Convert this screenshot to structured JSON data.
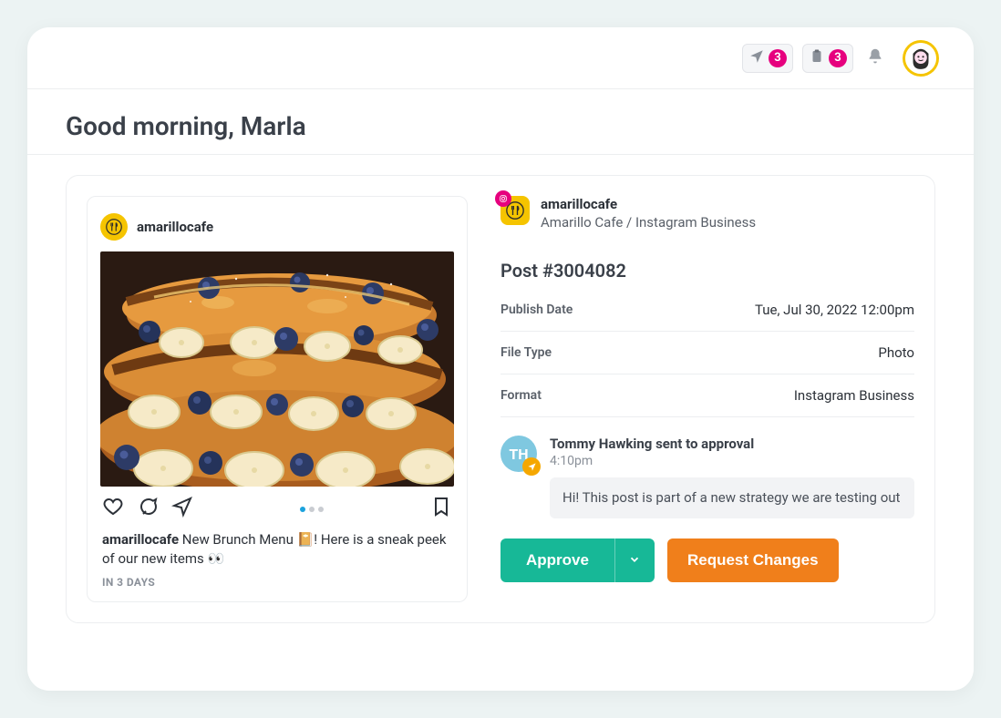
{
  "header": {
    "send_count": "3",
    "tasks_count": "3"
  },
  "greeting": "Good morning, Marla",
  "account": {
    "username": "amarillocafe",
    "display_line": "Amarillo Cafe / Instagram Business"
  },
  "preview": {
    "username": "amarillocafe",
    "caption_user": "amarillocafe",
    "caption_text": " New Brunch Menu 📔! Here is a sneak peek of our new items 👀",
    "schedule_label": "IN 3 DAYS"
  },
  "post": {
    "title": "Post #3004082",
    "meta": [
      {
        "label": "Publish Date",
        "value": "Tue, Jul 30, 2022 12:00pm"
      },
      {
        "label": "File Type",
        "value": "Photo"
      },
      {
        "label": "Format",
        "value": "Instagram Business"
      }
    ]
  },
  "activity": {
    "initials": "TH",
    "title": "Tommy Hawking sent to approval",
    "time": "4:10pm",
    "note": "Hi! This post is part of a new strategy we are testing out"
  },
  "actions": {
    "approve": "Approve",
    "request_changes": "Request Changes"
  }
}
